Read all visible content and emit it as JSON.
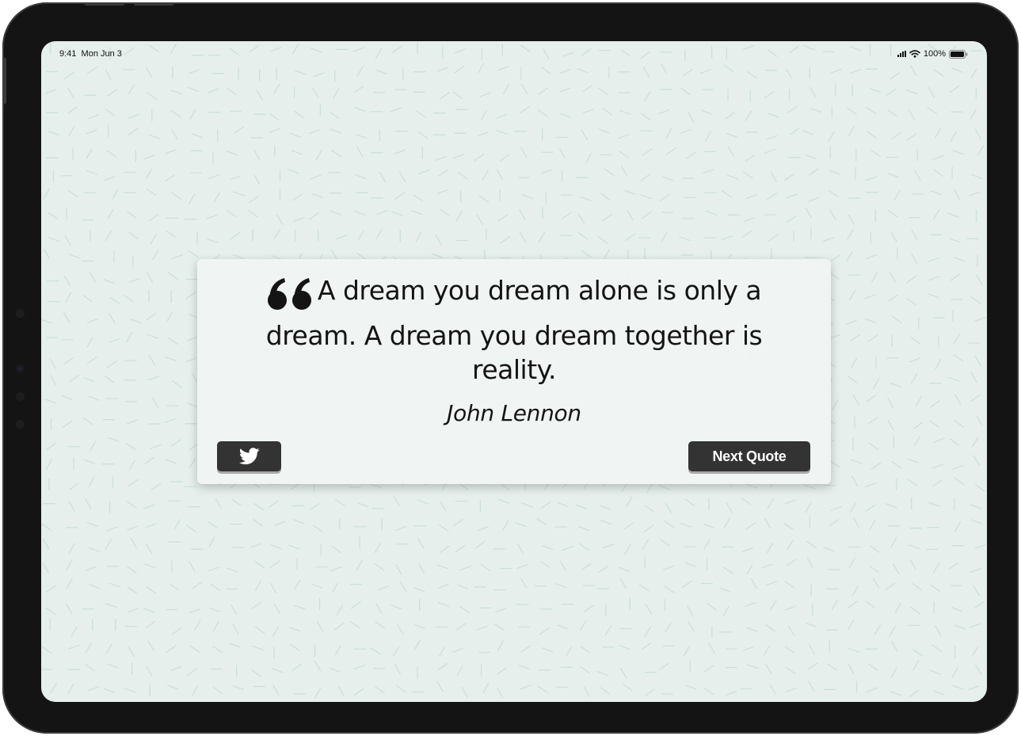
{
  "status_bar": {
    "time": "9:41",
    "date": "Mon Jun 3",
    "battery": "100%"
  },
  "quote": {
    "text": "A dream you dream alone is only a dream. A dream you dream together is reality.",
    "author": "John Lennon"
  },
  "actions": {
    "tweet_icon": "twitter-icon",
    "next_label": "Next Quote"
  },
  "colors": {
    "background": "#e6efeb",
    "pattern_stroke": "#c5dbd1",
    "button": "#333333",
    "text": "#141414",
    "device_frame": "#141414"
  }
}
